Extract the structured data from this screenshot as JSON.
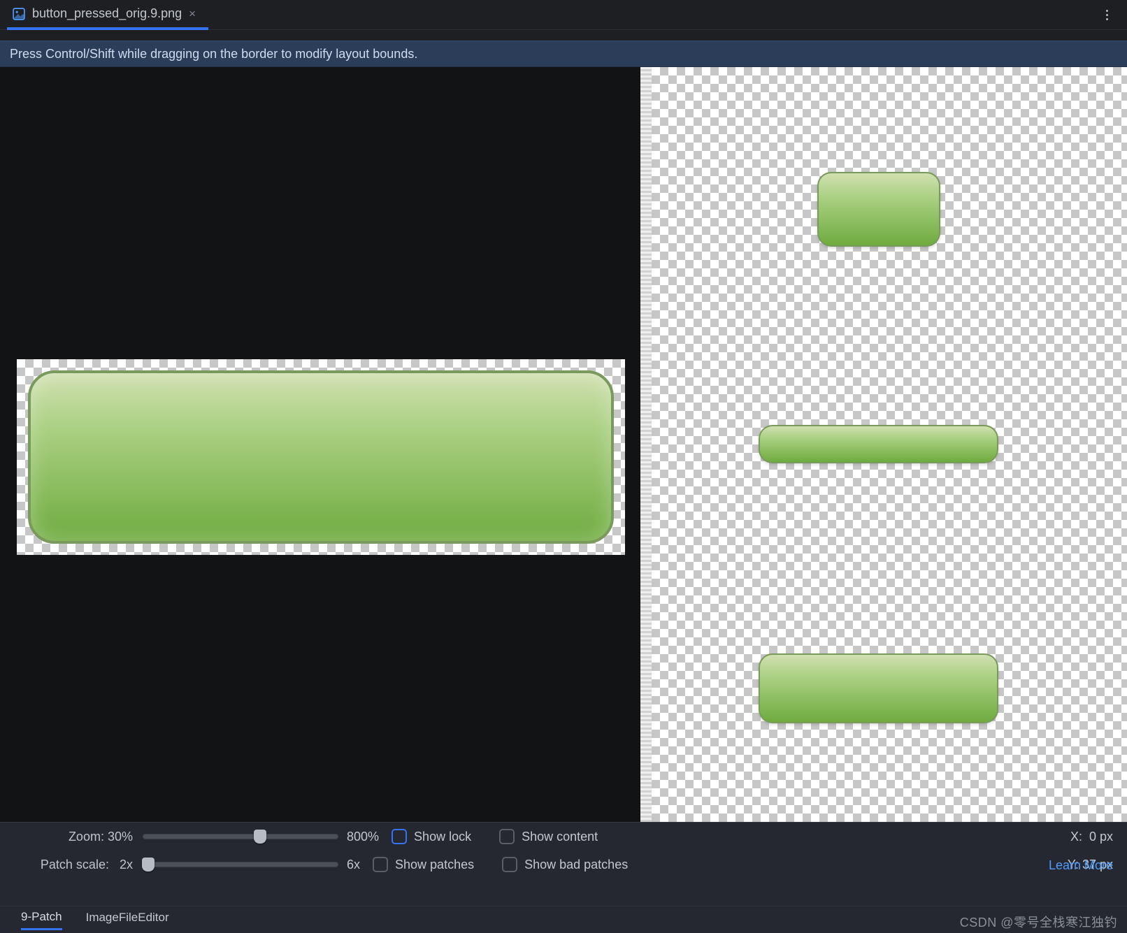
{
  "tab": {
    "filename": "button_pressed_orig.9.png"
  },
  "hint": "Press Control/Shift while dragging on the border to modify layout bounds.",
  "zoom": {
    "label": "Zoom:",
    "value": "30%",
    "min_label": "",
    "max_label": "800%",
    "slider_percent": 60
  },
  "patch_scale": {
    "label": "Patch scale:",
    "value": "2x",
    "max_label": "6x",
    "slider_percent": 3
  },
  "checks": {
    "show_lock": "Show lock",
    "show_content": "Show content",
    "show_patches": "Show patches",
    "show_bad_patches": "Show bad patches"
  },
  "coords": {
    "x_label": "X:",
    "x_value": "0 px",
    "y_label": "Y:",
    "y_value": "37 px"
  },
  "learn_more": "Learn More",
  "footer_tabs": {
    "t1": "9-Patch",
    "t2": "ImageFileEditor"
  },
  "watermark": "CSDN @零号全栈寒江独钓"
}
